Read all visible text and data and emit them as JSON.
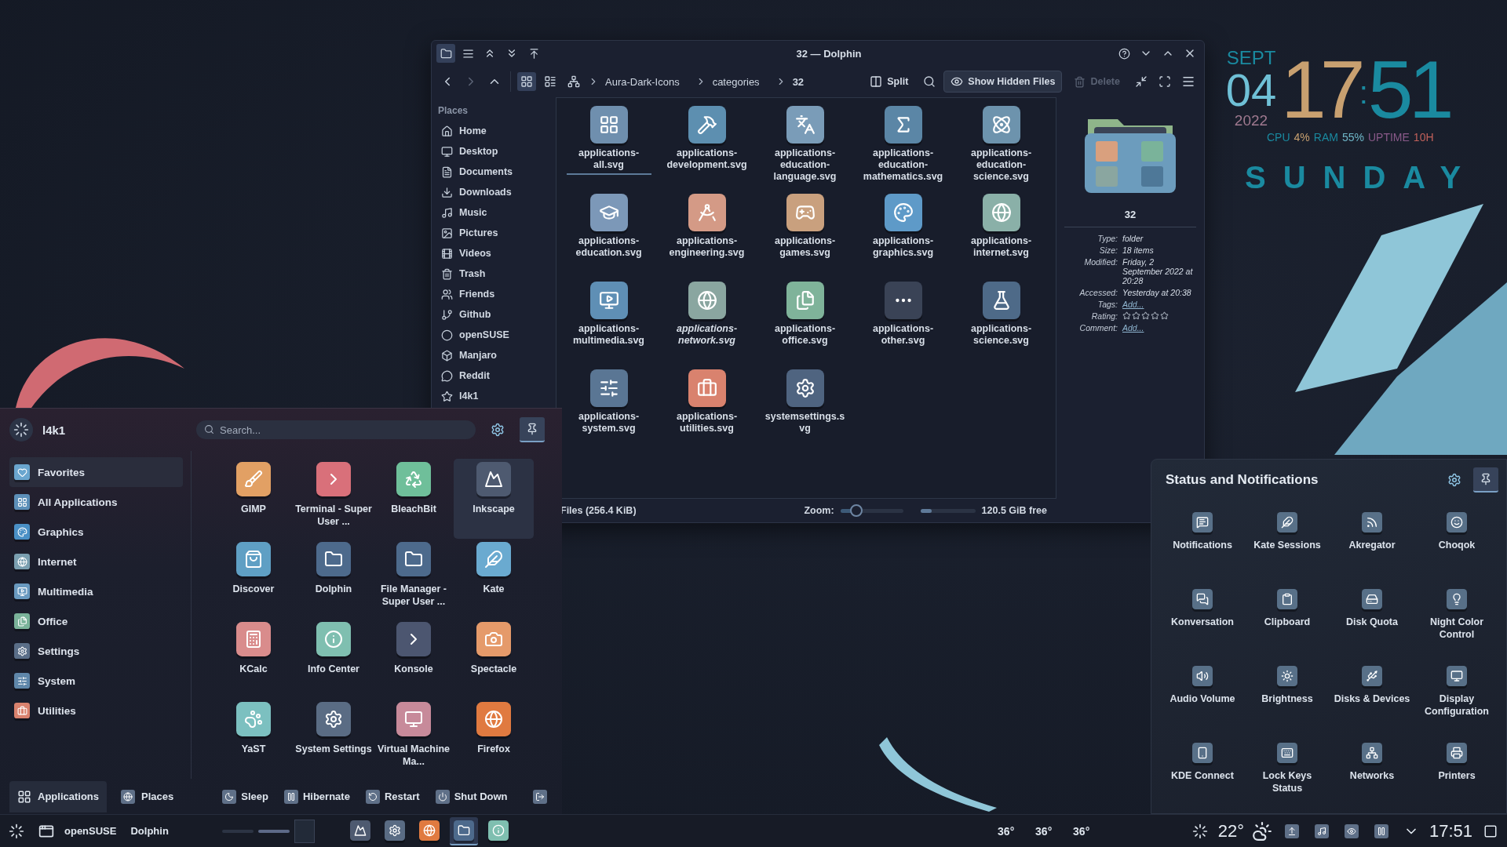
{
  "dolphin": {
    "title": "32 — Dolphin",
    "view_modes": [
      {
        "selected": true
      },
      {
        "selected": false
      },
      {
        "selected": false
      }
    ],
    "breadcrumb": [
      {
        "label": "Aura-Dark-Icons",
        "selected": false
      },
      {
        "label": "categories",
        "selected": false
      },
      {
        "label": "32",
        "selected": true
      }
    ],
    "toolbar": {
      "split": "Split",
      "hidden_files": {
        "label": "Show Hidden Files",
        "checked": true
      },
      "delete": {
        "label": "Delete",
        "disabled": true
      }
    },
    "places": {
      "heading": "Places",
      "items": [
        "Home",
        "Desktop",
        "Documents",
        "Downloads",
        "Music",
        "Pictures",
        "Videos",
        "Trash",
        "Friends",
        "Github",
        "openSUSE",
        "Manjaro",
        "Reddit",
        "l4k1"
      ]
    },
    "files": [
      {
        "name": "applications-all.svg",
        "selected": true,
        "italic": false
      },
      {
        "name": "applications-development.svg",
        "selected": false,
        "italic": false
      },
      {
        "name": "applications-education-language.svg",
        "selected": false,
        "italic": false
      },
      {
        "name": "applications-education-mathematics.svg",
        "selected": false,
        "italic": false
      },
      {
        "name": "applications-education-science.svg",
        "selected": false,
        "italic": false
      },
      {
        "name": "applications-education.svg",
        "selected": false,
        "italic": false
      },
      {
        "name": "applications-engineering.svg",
        "selected": false,
        "italic": false
      },
      {
        "name": "applications-games.svg",
        "selected": false,
        "italic": false
      },
      {
        "name": "applications-graphics.svg",
        "selected": false,
        "italic": false
      },
      {
        "name": "applications-internet.svg",
        "selected": false,
        "italic": false
      },
      {
        "name": "applications-multimedia.svg",
        "selected": false,
        "italic": false
      },
      {
        "name": "applications-network.svg",
        "selected": false,
        "italic": true
      },
      {
        "name": "applications-office.svg",
        "selected": false,
        "italic": false
      },
      {
        "name": "applications-other.svg",
        "selected": false,
        "italic": false
      },
      {
        "name": "applications-science.svg",
        "selected": false,
        "italic": false
      },
      {
        "name": "applications-system.svg",
        "selected": false,
        "italic": false
      },
      {
        "name": "applications-utilities.svg",
        "selected": false,
        "italic": false
      },
      {
        "name": "systemsettings.svg",
        "selected": false,
        "italic": false
      }
    ],
    "info": {
      "name": "32",
      "properties": [
        {
          "label": "Type:",
          "kind": "text",
          "value": "folder"
        },
        {
          "label": "Size:",
          "kind": "text",
          "value": "18 items"
        },
        {
          "label": "Modified:",
          "kind": "text",
          "value": "Friday, 2 September 2022 at 20:28"
        },
        {
          "label": "Accessed:",
          "kind": "text",
          "value": "Yesterday at 20:38"
        },
        {
          "label": "Tags:",
          "kind": "link",
          "value": "Add..."
        },
        {
          "label": "Rating:",
          "kind": "stars",
          "stars": 0
        },
        {
          "label": "Comment:",
          "kind": "link",
          "value": "Add..."
        }
      ]
    },
    "status": {
      "files": "Files (256.4 KiB)",
      "zoom_label": "Zoom:",
      "zoom": {
        "level": 0.25
      },
      "space": {
        "level": 0.2
      },
      "free": "120.5 GiB free"
    }
  },
  "clock": {
    "month": "SEPT",
    "day": "04",
    "year": "2022",
    "hours": "17",
    "separator": ":",
    "minutes": "51",
    "stats": [
      "CPU",
      "4%",
      "RAM",
      "55%",
      "UPTIME",
      "10H"
    ],
    "weekday": "SUNDAY"
  },
  "menu": {
    "user": "l4k1",
    "search": {
      "placeholder": "Search..."
    },
    "pinned": true,
    "categories": [
      {
        "label": "Favorites",
        "selected": true
      },
      {
        "label": "All Applications",
        "selected": false
      },
      {
        "label": "Graphics",
        "selected": false
      },
      {
        "label": "Internet",
        "selected": false
      },
      {
        "label": "Multimedia",
        "selected": false
      },
      {
        "label": "Office",
        "selected": false
      },
      {
        "label": "Settings",
        "selected": false
      },
      {
        "label": "System",
        "selected": false
      },
      {
        "label": "Utilities",
        "selected": false
      }
    ],
    "apps": [
      {
        "label": "GIMP",
        "selected": false
      },
      {
        "label": "Terminal - Super User ...",
        "selected": false
      },
      {
        "label": "BleachBit",
        "selected": false
      },
      {
        "label": "Inkscape",
        "selected": true
      },
      {
        "label": "Discover",
        "selected": false
      },
      {
        "label": "Dolphin",
        "selected": false
      },
      {
        "label": "File Manager - Super User ...",
        "selected": false
      },
      {
        "label": "Kate",
        "selected": false
      },
      {
        "label": "KCalc",
        "selected": false
      },
      {
        "label": "Info Center",
        "selected": false
      },
      {
        "label": "Konsole",
        "selected": false
      },
      {
        "label": "Spectacle",
        "selected": false
      },
      {
        "label": "YaST",
        "selected": false
      },
      {
        "label": "System Settings",
        "selected": false
      },
      {
        "label": "Virtual Machine Ma...",
        "selected": false
      },
      {
        "label": "Firefox",
        "selected": false
      }
    ],
    "tabs": [
      {
        "label": "Applications",
        "selected": true
      },
      {
        "label": "Places",
        "selected": false
      }
    ],
    "actions": [
      "Sleep",
      "Hibernate",
      "Restart",
      "Shut Down"
    ]
  },
  "status_panel": {
    "title": "Status and Notifications",
    "pinned": true,
    "items": [
      "Notifications",
      "Kate Sessions",
      "Akregator",
      "Choqok",
      "Konversation",
      "Clipboard",
      "Disk Quota",
      "Night Color Control",
      "Audio Volume",
      "Brightness",
      "Disks & Devices",
      "Display Configuration",
      "KDE Connect",
      "Lock Keys Status",
      "Networks",
      "Printers"
    ]
  },
  "taskbar": {
    "distro": "openSUSE",
    "window": "Dolphin",
    "tasks": [
      {
        "selected": false
      },
      {
        "selected": false
      },
      {
        "selected": false
      },
      {
        "selected": true
      },
      {
        "selected": false
      }
    ],
    "temperatures": [
      "36°",
      "36°",
      "36°"
    ],
    "weather": "22°",
    "clock": "17:51"
  }
}
